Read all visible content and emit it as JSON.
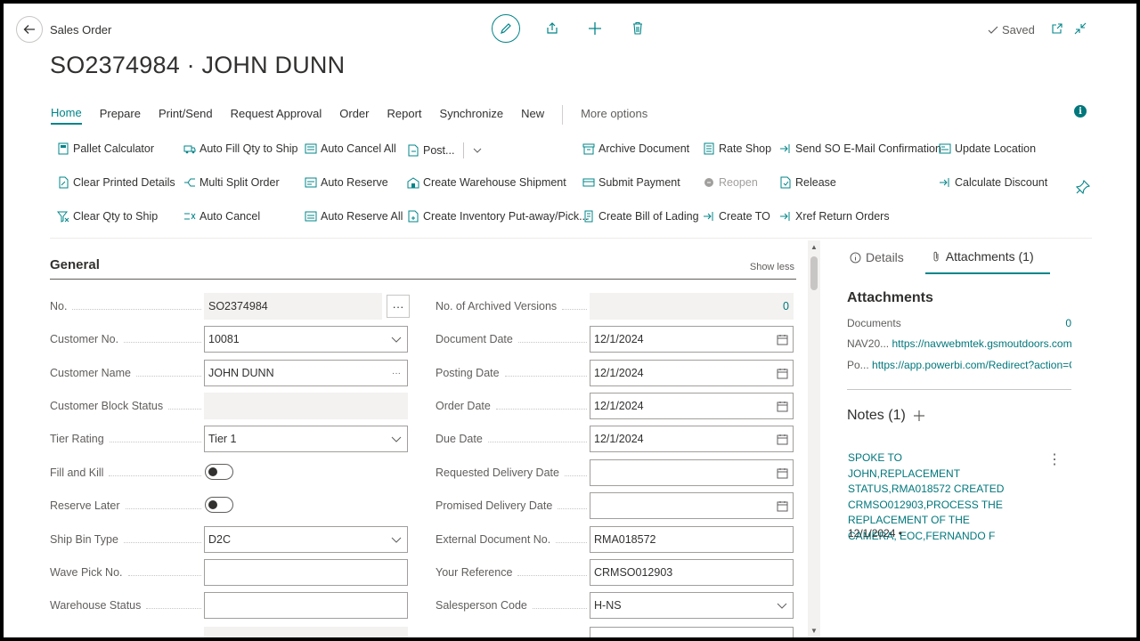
{
  "header": {
    "page_type": "Sales Order",
    "title": "SO2374984 · JOHN DUNN",
    "saved": "Saved"
  },
  "tabs": [
    "Home",
    "Prepare",
    "Print/Send",
    "Request Approval",
    "Order",
    "Report",
    "Synchronize",
    "New"
  ],
  "more_options": "More options",
  "actions": {
    "pallet_calculator": "Pallet Calculator",
    "clear_printed_details": "Clear Printed Details",
    "clear_qty_to_ship": "Clear Qty to Ship",
    "auto_fill_qty": "Auto Fill Qty to Ship",
    "multi_split_order": "Multi Split Order",
    "auto_cancel": "Auto Cancel",
    "auto_cancel_all": "Auto Cancel All",
    "auto_reserve": "Auto Reserve",
    "auto_reserve_all": "Auto Reserve All",
    "post": "Post...",
    "create_warehouse_shipment": "Create Warehouse Shipment",
    "create_inventory_putaway": "Create Inventory Put-away/Pick...",
    "archive_document": "Archive Document",
    "submit_payment": "Submit Payment",
    "create_bill_of_lading": "Create Bill of Lading",
    "rate_shop": "Rate Shop",
    "reopen": "Reopen",
    "create_to": "Create TO",
    "send_so_email": "Send SO E-Mail Confirmation",
    "release": "Release",
    "xref_return_orders": "Xref Return Orders",
    "update_location": "Update Location",
    "calculate_discount": "Calculate Discount"
  },
  "general": {
    "title": "General",
    "show_less": "Show less",
    "left": [
      {
        "label": "No.",
        "value": "SO2374984"
      },
      {
        "label": "Customer No.",
        "value": "10081"
      },
      {
        "label": "Customer Name",
        "value": "JOHN DUNN"
      },
      {
        "label": "Customer Block Status",
        "value": ""
      },
      {
        "label": "Tier Rating",
        "value": "Tier 1"
      },
      {
        "label": "Fill and Kill",
        "value": ""
      },
      {
        "label": "Reserve Later",
        "value": ""
      },
      {
        "label": "Ship Bin Type",
        "value": "D2C"
      },
      {
        "label": "Wave Pick No.",
        "value": ""
      },
      {
        "label": "Warehouse Status",
        "value": ""
      }
    ],
    "right": [
      {
        "label": "No. of Archived Versions",
        "value": "0"
      },
      {
        "label": "Document Date",
        "value": "12/1/2024"
      },
      {
        "label": "Posting Date",
        "value": "12/1/2024"
      },
      {
        "label": "Order Date",
        "value": "12/1/2024"
      },
      {
        "label": "Due Date",
        "value": "12/1/2024"
      },
      {
        "label": "Requested Delivery Date",
        "value": ""
      },
      {
        "label": "Promised Delivery Date",
        "value": ""
      },
      {
        "label": "External Document No.",
        "value": "RMA018572"
      },
      {
        "label": "Your Reference",
        "value": "CRMSO012903"
      },
      {
        "label": "Salesperson Code",
        "value": "H-NS"
      }
    ]
  },
  "factbox": {
    "tab_details": "Details",
    "tab_attachments": "Attachments (1)",
    "attachments_title": "Attachments",
    "documents_label": "Documents",
    "documents_count": "0",
    "link1_prefix": "NAV20...",
    "link1": "https://navwebmtek.gsmoutdoors.com:8...",
    "link2_prefix": "Po...",
    "link2": "https://app.powerbi.com/Redirect?action=Op...",
    "notes_title": "Notes (1)",
    "note_text": "SPOKE TO JOHN,REPLACEMENT STATUS,RMA018572 CREATED CRMSO012903,PROCESS THE REPLACEMENT OF THE CAMERA, EOC,FERNANDO F",
    "note_date": "12/1/2024 •"
  },
  "colors": {
    "accent": "#008489",
    "text": "#323130",
    "muted": "#605e5c"
  }
}
